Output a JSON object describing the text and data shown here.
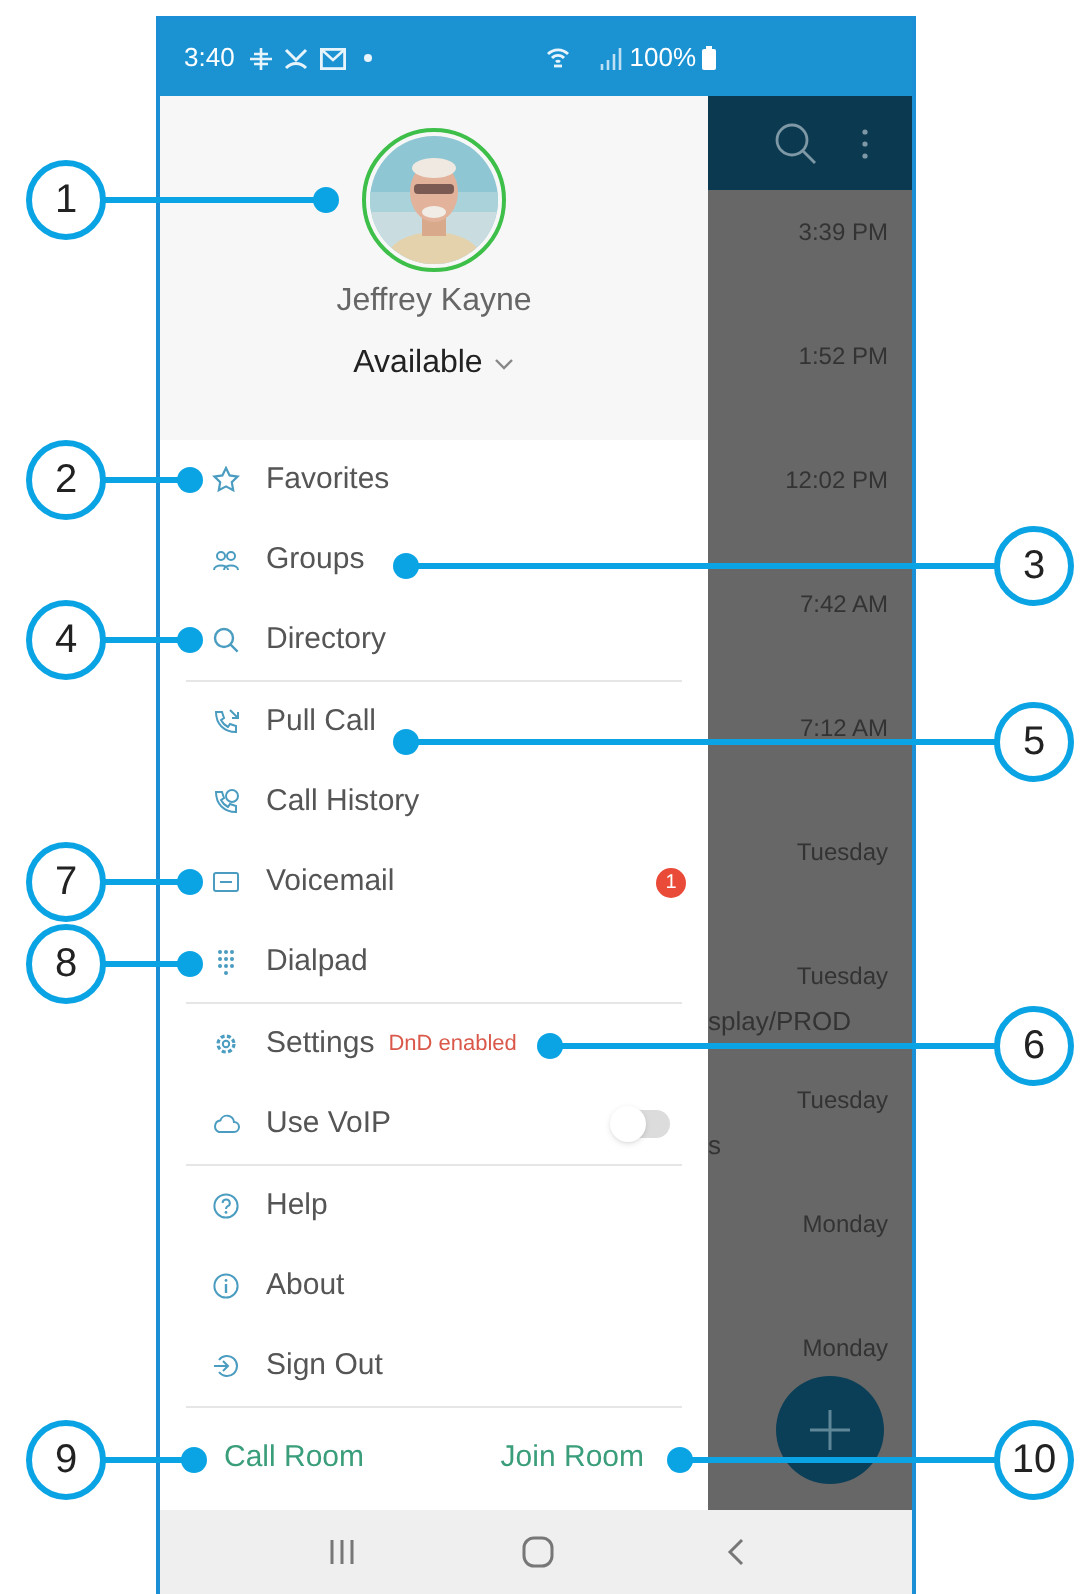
{
  "status_bar": {
    "time": "3:40",
    "battery": "100%"
  },
  "drawer": {
    "profile": {
      "name": "Jeffrey Kayne",
      "presence": "Available"
    },
    "menu_sections": [
      [
        {
          "kind": "item",
          "label": "Favorites"
        },
        {
          "kind": "item",
          "label": "Groups"
        },
        {
          "kind": "item",
          "label": "Directory"
        }
      ],
      [
        {
          "kind": "item",
          "label": "Pull Call"
        },
        {
          "kind": "item",
          "label": "Call History"
        },
        {
          "kind": "item",
          "label": "Voicemail",
          "badge": "1"
        },
        {
          "kind": "item",
          "label": "Dialpad"
        }
      ],
      [
        {
          "kind": "item",
          "label": "Settings",
          "note": "DnD enabled"
        },
        {
          "kind": "toggle",
          "label": "Use VoIP",
          "on": false
        }
      ],
      [
        {
          "kind": "item",
          "label": "Help"
        },
        {
          "kind": "item",
          "label": "About"
        },
        {
          "kind": "item",
          "label": "Sign Out"
        }
      ]
    ],
    "footer_links": [
      "Call Room",
      "Join Room"
    ]
  },
  "background_list": [
    {
      "time": "3:39 PM"
    },
    {
      "time": "1:52 PM"
    },
    {
      "time": "12:02 PM"
    },
    {
      "time": "7:42 AM"
    },
    {
      "time": "7:12 AM"
    },
    {
      "time": "Tuesday"
    },
    {
      "time": "Tuesday",
      "fragment": "splay/PROD"
    },
    {
      "time": "Tuesday",
      "fragment": "s"
    },
    {
      "time": "Monday"
    },
    {
      "time": "Monday"
    }
  ],
  "callouts": [
    {
      "label": "1"
    },
    {
      "label": "2"
    },
    {
      "label": "3"
    },
    {
      "label": "4"
    },
    {
      "label": "5"
    },
    {
      "label": "7"
    },
    {
      "label": "8"
    },
    {
      "label": "6"
    },
    {
      "label": "9"
    },
    {
      "label": "10"
    }
  ]
}
